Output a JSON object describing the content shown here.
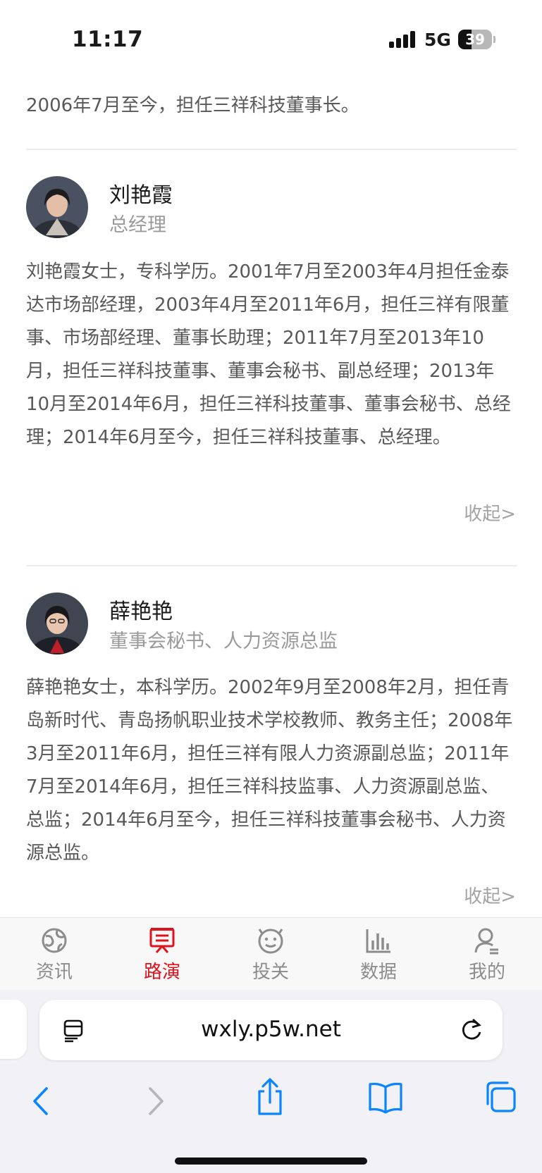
{
  "status_bar": {
    "time": "11:17",
    "network": "5G",
    "battery": "39",
    "battery_level": 0.39
  },
  "profiles": {
    "prev_tail": "2006年7月至今，担任三祥科技董事长。",
    "people": [
      {
        "name": "刘艳霞",
        "title": "总经理",
        "bio": "刘艳霞女士，专科学历。2001年7月至2003年4月担任金泰达市场部经理，2003年4月至2011年6月，担任三祥有限董事、市场部经理、董事长助理；2011年7月至2013年10月，担任三祥科技董事、董事会秘书、副总经理；2013年10月至2014年6月，担任三祥科技董事、董事会秘书、总经理；2014年6月至今，担任三祥科技董事、总经理。",
        "collapse": "收起>"
      },
      {
        "name": "薛艳艳",
        "title": "董事会秘书、人力资源总监",
        "bio": "薛艳艳女士，本科学历。2002年9月至2008年2月，担任青岛新时代、青岛扬帆职业技术学校教师、教务主任；2008年3月至2011年6月，担任三祥有限人力资源副总监；2011年7月至2014年6月，担任三祥科技监事、人力资源副总监、总监；2014年6月至今，担任三祥科技董事会秘书、人力资源总监。",
        "collapse": "收起>"
      }
    ]
  },
  "tabbar": {
    "active_color": "#e0121b",
    "inactive_color": "#8c8c8c",
    "tabs": [
      {
        "label": "资讯",
        "icon": "globe-icon"
      },
      {
        "label": "路演",
        "icon": "roadshow-icon"
      },
      {
        "label": "投关",
        "icon": "smile-icon"
      },
      {
        "label": "数据",
        "icon": "bar-chart-icon"
      },
      {
        "label": "我的",
        "icon": "user-icon"
      }
    ]
  },
  "browser": {
    "url": "wxly.p5w.net",
    "accent": "#0a84ff"
  }
}
